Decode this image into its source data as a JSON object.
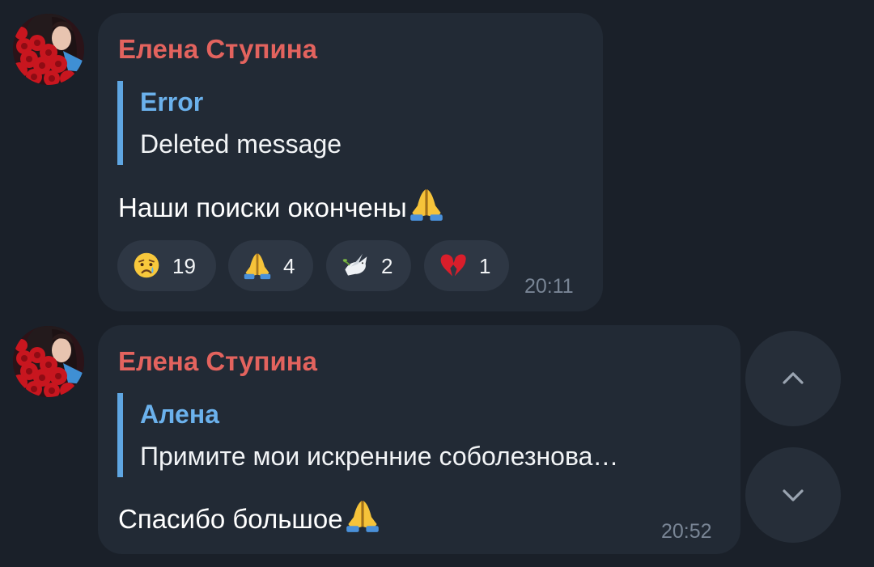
{
  "messages": [
    {
      "sender": "Елена Ступина",
      "reply": {
        "author": "Error",
        "text": "Deleted message"
      },
      "text": "Наши поиски окончены",
      "text_emoji": "praying-hands",
      "reactions": [
        {
          "icon": "crying-face",
          "count": "19"
        },
        {
          "icon": "praying-hands",
          "count": "4"
        },
        {
          "icon": "dove",
          "count": "2"
        },
        {
          "icon": "broken-heart",
          "count": "1"
        }
      ],
      "time": "20:11"
    },
    {
      "sender": "Елена Ступина",
      "reply": {
        "author": "Алена",
        "text": "Примите мои искренние соболезнова…"
      },
      "text": "Спасибо большое",
      "text_emoji": "praying-hands",
      "time": "20:52"
    }
  ],
  "navigation": {
    "up_icon": "chevron-up-icon",
    "down_icon": "chevron-down-icon"
  },
  "colors": {
    "background": "#1a2029",
    "bubble": "#222a35",
    "sender_name": "#e3635e",
    "reply_accent": "#5fa6e2",
    "reaction_pill": "#2e3744",
    "timestamp": "#798595"
  }
}
